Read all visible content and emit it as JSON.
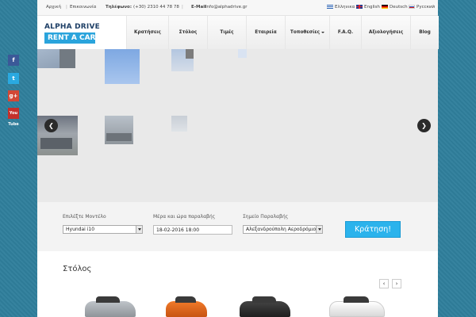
{
  "topbar": {
    "home": "Αρχική",
    "contact": "Επικοινωνία",
    "phone_label": "Τηλέφωνο:",
    "phone_value": "(+30) 2310 44 78 78",
    "email_label": "E-Mail",
    "email_value": "info@alphadrive.gr",
    "languages": [
      "Ελληνικα",
      "English",
      "Deutsch",
      "Русский"
    ]
  },
  "logo": {
    "line1": "ALPHA DRIVE",
    "line2": "RENT A CAR"
  },
  "nav": [
    "Κρατήσεις",
    "Στόλος",
    "Τιμές",
    "Εταιρεία",
    "Τοποθεσίες",
    "F.A.Q.",
    "Αξιολογήσεις",
    "Blog"
  ],
  "slider": {
    "prev": "❮",
    "next": "❯"
  },
  "booking": {
    "model_label": "Επιλέξτε Μοντέλο",
    "model_value": "Hyundai i10",
    "date_label": "Μέρα και ώρα παραλαβής",
    "date_value": "18-02-2016 18:00",
    "location_label": "Σημείο Παραλαβής",
    "location_value": "Αλεξανδρούπολη Αεροδρόμιο",
    "submit": "Κράτηση!"
  },
  "fleet": {
    "title": "Στόλος",
    "prev": "‹",
    "next": "›"
  },
  "social": {
    "facebook": "f",
    "twitter": "t",
    "googleplus": "g+",
    "youtube": "You Tube"
  }
}
